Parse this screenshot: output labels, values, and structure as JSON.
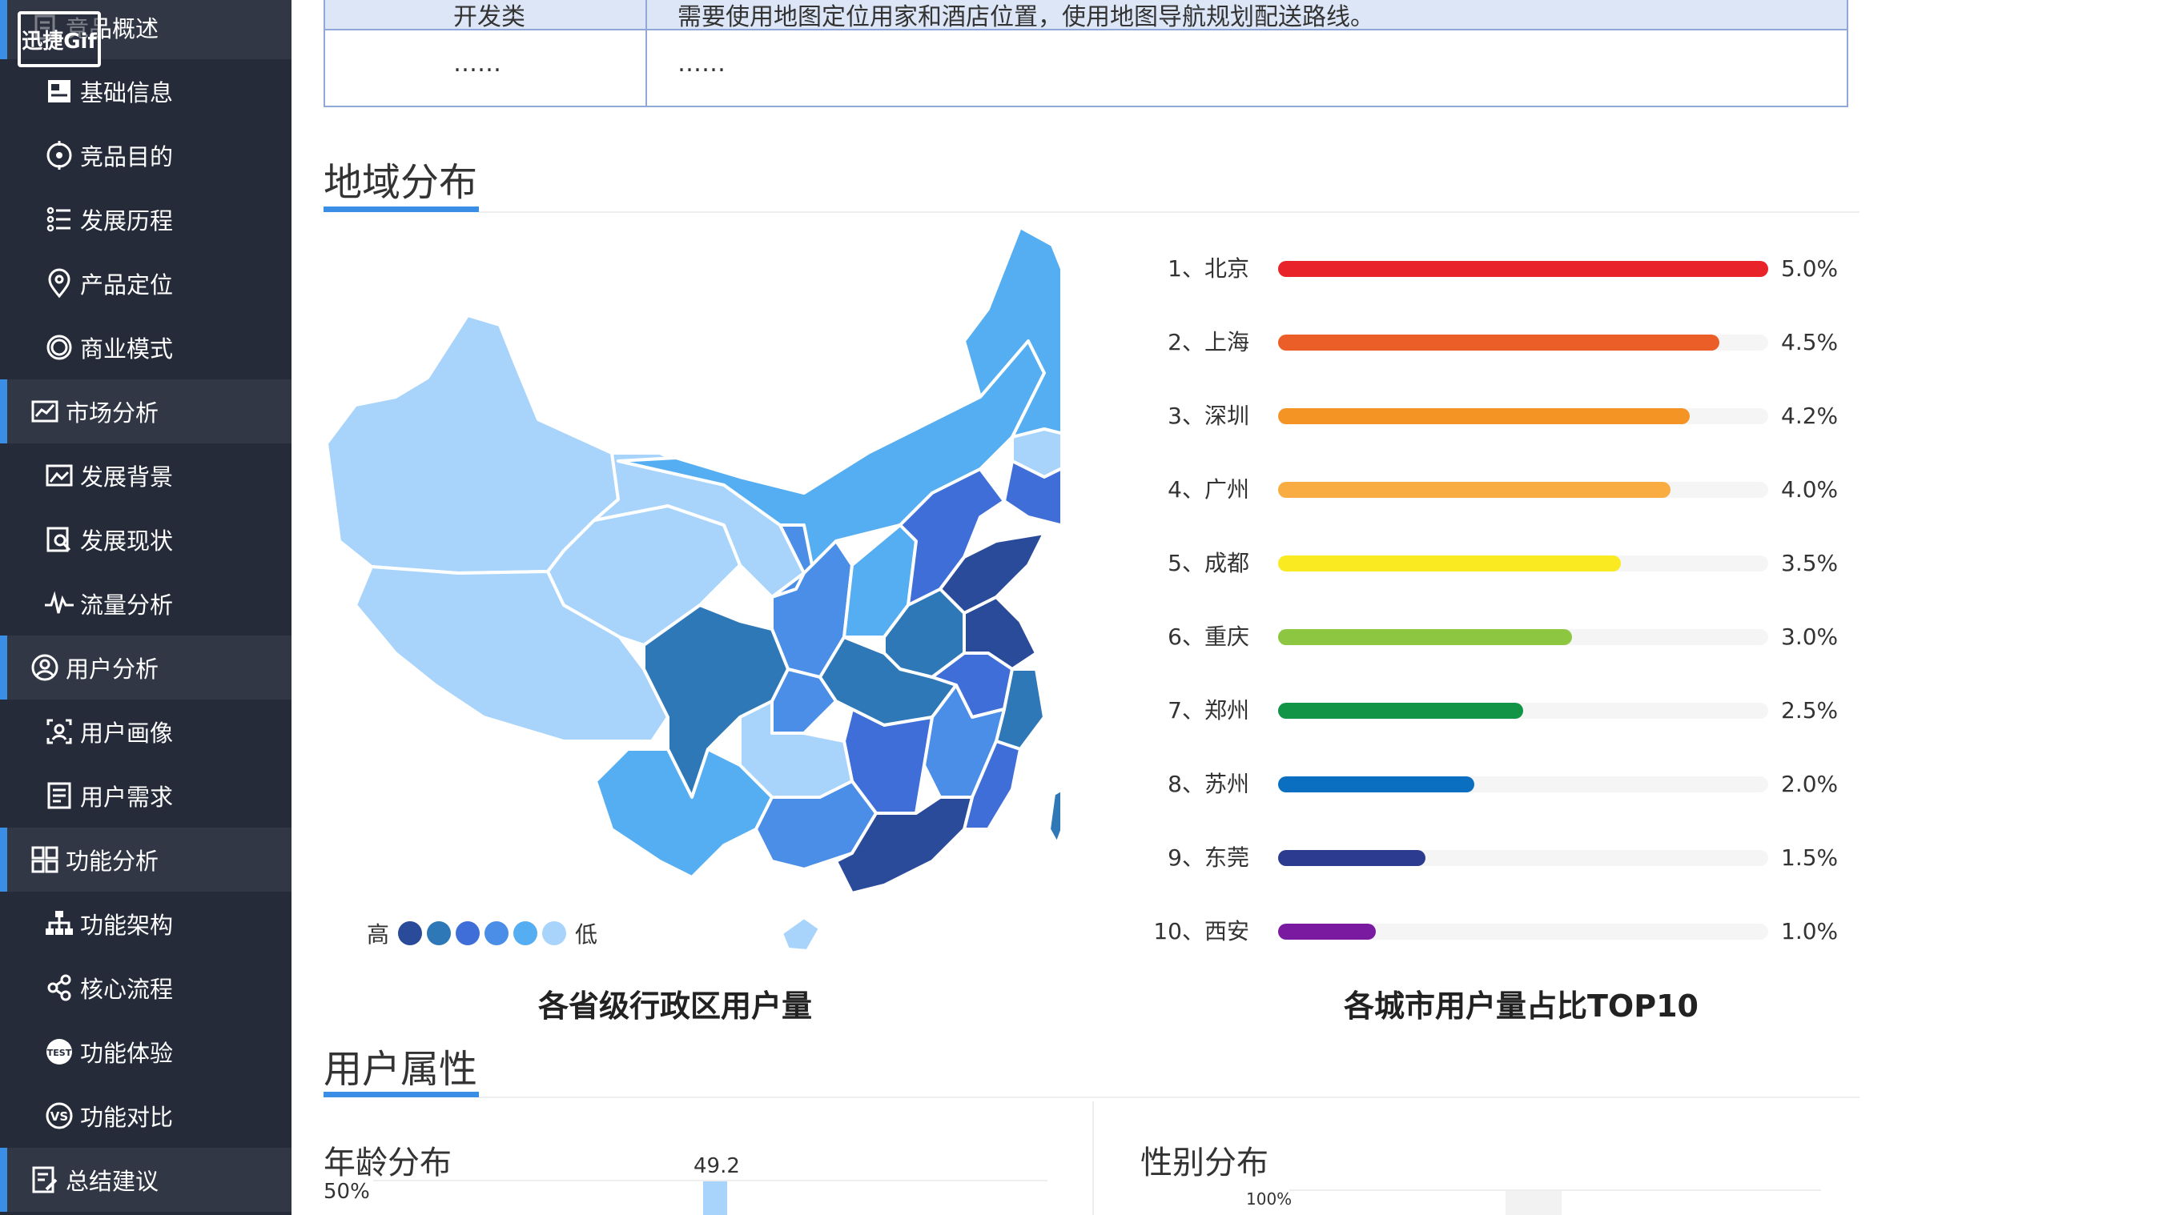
{
  "badge": "迅捷Gif",
  "sidebar": {
    "items": [
      {
        "label": "竞品概述",
        "type": "section",
        "icon": "document-icon"
      },
      {
        "label": "基础信息",
        "type": "sub",
        "icon": "info-card-icon"
      },
      {
        "label": "竞品目的",
        "type": "sub",
        "icon": "target-icon"
      },
      {
        "label": "发展历程",
        "type": "sub",
        "icon": "timeline-icon"
      },
      {
        "label": "产品定位",
        "type": "sub",
        "icon": "location-pin-icon"
      },
      {
        "label": "商业模式",
        "type": "sub",
        "icon": "ring-icon"
      },
      {
        "label": "市场分析",
        "type": "section",
        "icon": "chart-icon"
      },
      {
        "label": "发展背景",
        "type": "sub",
        "icon": "picture-chart-icon"
      },
      {
        "label": "发展现状",
        "type": "sub",
        "icon": "magnify-doc-icon"
      },
      {
        "label": "流量分析",
        "type": "sub",
        "icon": "pulse-icon"
      },
      {
        "label": "用户分析",
        "type": "section",
        "icon": "user-circle-icon"
      },
      {
        "label": "用户画像",
        "type": "sub",
        "icon": "user-frame-icon"
      },
      {
        "label": "用户需求",
        "type": "sub",
        "icon": "list-doc-icon"
      },
      {
        "label": "功能分析",
        "type": "section",
        "icon": "grid-icon"
      },
      {
        "label": "功能架构",
        "type": "sub",
        "icon": "hierarchy-icon"
      },
      {
        "label": "核心流程",
        "type": "sub",
        "icon": "flow-icon"
      },
      {
        "label": "功能体验",
        "type": "sub",
        "icon": "test-badge-icon"
      },
      {
        "label": "功能对比",
        "type": "sub",
        "icon": "vs-icon"
      },
      {
        "label": "总结建议",
        "type": "section",
        "icon": "edit-doc-icon"
      }
    ]
  },
  "top_table": {
    "row1_col1": "开发类",
    "row1_col2": "需要使用地图定位用家和酒店位置，使用地图导航规划配送路线。",
    "row2_col1": "……",
    "row2_col2": "……"
  },
  "region_section": {
    "title": "地域分布",
    "map_caption": "各省级行政区用户量",
    "legend_high": "高",
    "legend_low": "低",
    "legend_colors": [
      "#2a4a9a",
      "#2e78b8",
      "#3f6ed8",
      "#4a8ee8",
      "#55aef2",
      "#a8d4fb"
    ],
    "ranking_caption": "各城市用户量占比TOP10"
  },
  "chart_data": {
    "type": "bar",
    "title": "各城市用户量占比TOP10",
    "categories": [
      "1、北京",
      "2、上海",
      "3、深圳",
      "4、广州",
      "5、成都",
      "6、重庆",
      "7、郑州",
      "8、苏州",
      "9、东莞",
      "10、西安"
    ],
    "values": [
      5.0,
      4.5,
      4.2,
      4.0,
      3.5,
      3.0,
      2.5,
      2.0,
      1.5,
      1.0
    ],
    "labels": [
      "5.0%",
      "4.5%",
      "4.2%",
      "4.0%",
      "3.5%",
      "3.0%",
      "2.5%",
      "2.0%",
      "1.5%",
      "1.0%"
    ],
    "colors": [
      "#e8232a",
      "#eb5e28",
      "#f39425",
      "#f9ac42",
      "#f9ea22",
      "#8dc741",
      "#119445",
      "#0a6fc0",
      "#2c3a8f",
      "#7a1aa0"
    ],
    "xlim": [
      0,
      5.0
    ],
    "orientation": "horizontal"
  },
  "attributes_section": {
    "title": "用户属性",
    "age_title": "年龄分布",
    "age_axis_label": "50%",
    "age_bar_value": "49.2",
    "gender_title": "性别分布",
    "gender_axis_label": "100%"
  }
}
